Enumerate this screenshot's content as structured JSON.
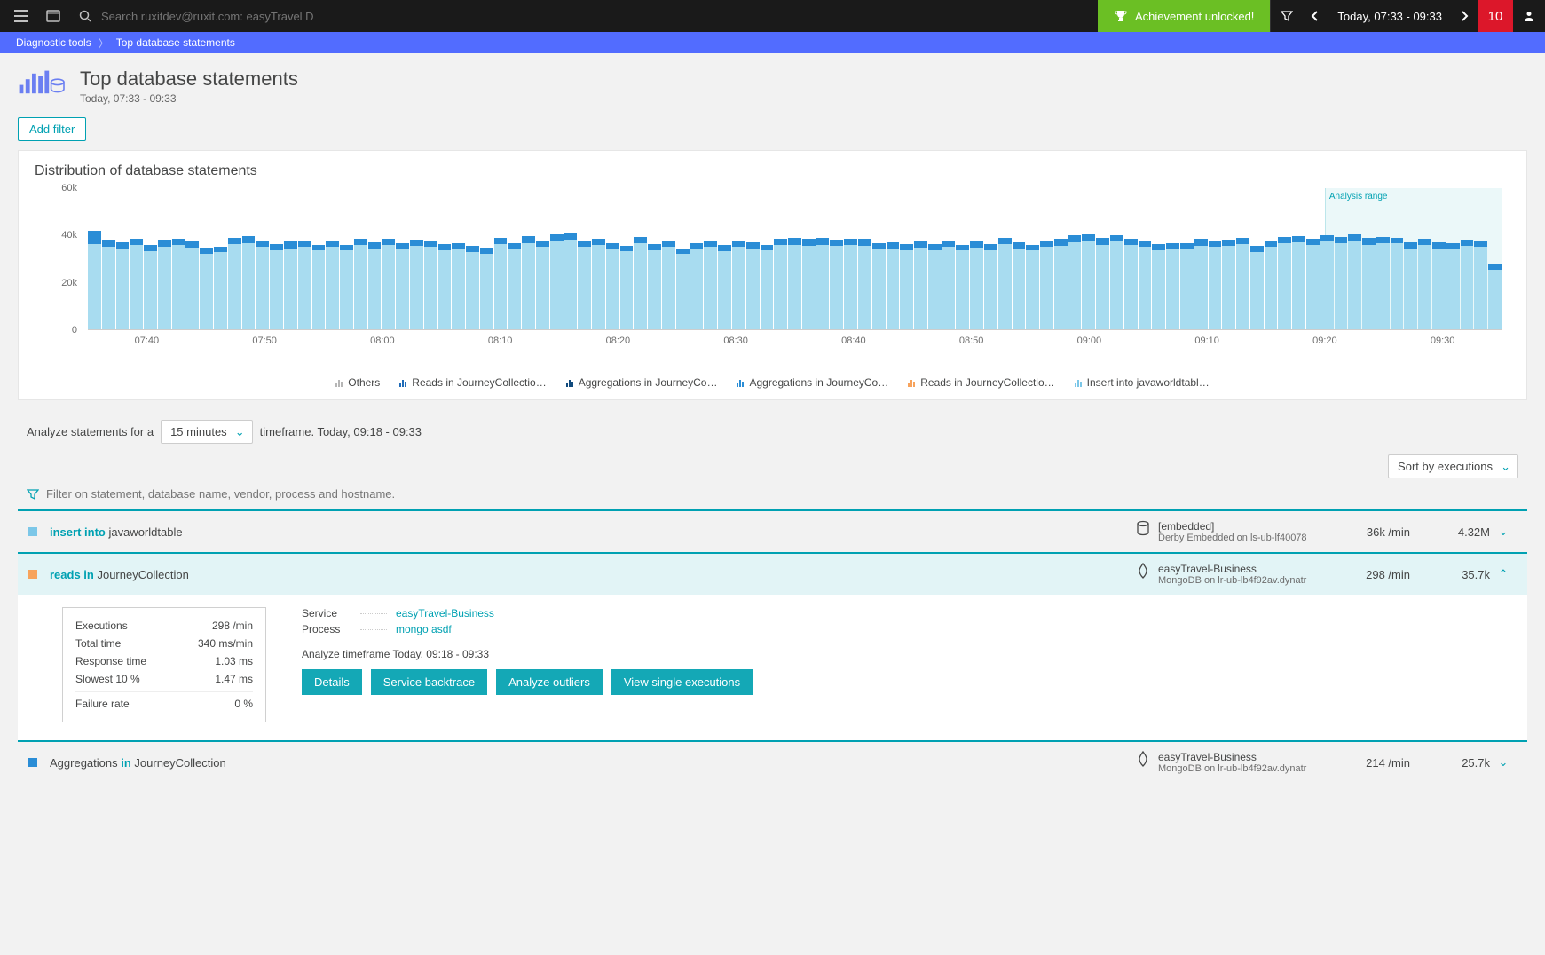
{
  "topbar": {
    "search_placeholder": "Search ruxitdev@ruxit.com: easyTravel Dev...",
    "achievement": "Achievement unlocked!",
    "time_range": "Today, 07:33 - 09:33",
    "problem_count": "10"
  },
  "breadcrumb": [
    "Diagnostic tools",
    "Top database statements"
  ],
  "page": {
    "title": "Top database statements",
    "subtitle": "Today, 07:33 - 09:33",
    "add_filter": "Add filter",
    "dist_heading": "Distribution of database statements",
    "analysis_range_label": "Analysis range",
    "analyze_prefix": "Analyze statements for a",
    "analyze_select": "15 minutes",
    "analyze_suffix": "timeframe. Today, 09:18 - 09:33",
    "sort_label": "Sort by executions",
    "filter_placeholder": "Filter on statement, database name, vendor, process and hostname."
  },
  "legend": [
    {
      "label": "Others",
      "color": "#b6b6b6"
    },
    {
      "label": "Reads in JourneyCollectio…",
      "color": "#1f6bb8"
    },
    {
      "label": "Aggregations in JourneyCo…",
      "color": "#104a7d"
    },
    {
      "label": "Aggregations in JourneyCo…",
      "color": "#2a8dd6"
    },
    {
      "label": "Reads in JourneyCollectio…",
      "color": "#f7a35c"
    },
    {
      "label": "Insert into javaworldtabl…",
      "color": "#7cc7e8"
    }
  ],
  "statements": [
    {
      "color": "#7cc7e8",
      "kw": "insert into",
      "rest": " javaworldtable",
      "db_name": "[embedded]",
      "db_sub": "Derby Embedded on ls-ub-lf40078",
      "rate": "36k /min",
      "total": "4.32M",
      "icon": "db"
    },
    {
      "color": "#f7a35c",
      "kw": "reads in",
      "rest": " JourneyCollection",
      "db_name": "easyTravel-Business",
      "db_sub": "MongoDB on lr-ub-lb4f92av.dynatr",
      "rate": "298 /min",
      "total": "35.7k",
      "icon": "mongo",
      "expanded": true
    },
    {
      "color": "#2a8dd6",
      "kw_pre": "Aggregations ",
      "kw": "in",
      "rest": " JourneyCollection",
      "db_name": "easyTravel-Business",
      "db_sub": "MongoDB on lr-ub-lb4f92av.dynatr",
      "rate": "214 /min",
      "total": "25.7k",
      "icon": "mongo"
    }
  ],
  "detail": {
    "metrics": [
      {
        "k": "Executions",
        "v": "298 /min"
      },
      {
        "k": "Total time",
        "v": "340 ms/min"
      },
      {
        "k": "Response time",
        "v": "1.03 ms"
      },
      {
        "k": "Slowest 10 %",
        "v": "1.47 ms"
      },
      {
        "k": "Failure rate",
        "v": "0 %",
        "sep": true
      }
    ],
    "service_label": "Service",
    "service_value": "easyTravel-Business",
    "process_label": "Process",
    "process_value": "mongo asdf",
    "tf": "Analyze timeframe Today, 09:18 - 09:33",
    "buttons": [
      "Details",
      "Service backtrace",
      "Analyze outliers",
      "View single executions"
    ]
  },
  "chart_data": {
    "type": "bar",
    "ylabel": "",
    "ylim": [
      0,
      60000
    ],
    "yticks": [
      "0",
      "20k",
      "40k",
      "60k"
    ],
    "xticks": [
      "07:40",
      "07:50",
      "08:00",
      "08:10",
      "08:20",
      "08:30",
      "08:40",
      "08:50",
      "09:00",
      "09:10",
      "09:20",
      "09:30"
    ],
    "analysis_start_frac": 0.875,
    "series_colors": {
      "insert": "#9fd5ea",
      "reads1": "#f7a35c",
      "agg1": "#2a8dd6",
      "agg2": "#104a7d",
      "reads2": "#1f6bb8",
      "others": "#b6b6b6"
    },
    "bars": [
      {
        "insert": 36000,
        "rest": 5500
      },
      {
        "insert": 35000,
        "rest": 3000
      },
      {
        "insert": 34000,
        "rest": 2800
      },
      {
        "insert": 35500,
        "rest": 2700
      },
      {
        "insert": 33000,
        "rest": 2500
      },
      {
        "insert": 35000,
        "rest": 2800
      },
      {
        "insert": 35800,
        "rest": 2600
      },
      {
        "insert": 34500,
        "rest": 2600
      },
      {
        "insert": 32000,
        "rest": 2500
      },
      {
        "insert": 32500,
        "rest": 2500
      },
      {
        "insert": 36000,
        "rest": 2700
      },
      {
        "insert": 36500,
        "rest": 2700
      },
      {
        "insert": 35000,
        "rest": 2600
      },
      {
        "insert": 33500,
        "rest": 2600
      },
      {
        "insert": 34000,
        "rest": 3000
      },
      {
        "insert": 35000,
        "rest": 2600
      },
      {
        "insert": 33200,
        "rest": 2600
      },
      {
        "insert": 34800,
        "rest": 2400
      },
      {
        "insert": 33200,
        "rest": 2500
      },
      {
        "insert": 35500,
        "rest": 2600
      },
      {
        "insert": 34200,
        "rest": 2600
      },
      {
        "insert": 35600,
        "rest": 2600
      },
      {
        "insert": 33800,
        "rest": 2500
      },
      {
        "insert": 35400,
        "rest": 2500
      },
      {
        "insert": 34800,
        "rest": 2700
      },
      {
        "insert": 33400,
        "rest": 2600
      },
      {
        "insert": 34000,
        "rest": 2500
      },
      {
        "insert": 32800,
        "rest": 2400
      },
      {
        "insert": 32000,
        "rest": 2500
      },
      {
        "insert": 36000,
        "rest": 2600
      },
      {
        "insert": 33800,
        "rest": 2500
      },
      {
        "insert": 36200,
        "rest": 3000
      },
      {
        "insert": 34800,
        "rest": 2700
      },
      {
        "insert": 37200,
        "rest": 2800
      },
      {
        "insert": 37800,
        "rest": 3000
      },
      {
        "insert": 34800,
        "rest": 2600
      },
      {
        "insert": 35500,
        "rest": 2600
      },
      {
        "insert": 33800,
        "rest": 2500
      },
      {
        "insert": 33000,
        "rest": 2400
      },
      {
        "insert": 36200,
        "rest": 2700
      },
      {
        "insert": 33400,
        "rest": 2600
      },
      {
        "insert": 34800,
        "rest": 2600
      },
      {
        "insert": 31800,
        "rest": 2500
      },
      {
        "insert": 33800,
        "rest": 2500
      },
      {
        "insert": 35000,
        "rest": 2600
      },
      {
        "insert": 33000,
        "rest": 2500
      },
      {
        "insert": 34800,
        "rest": 2700
      },
      {
        "insert": 34000,
        "rest": 2600
      },
      {
        "insert": 33200,
        "rest": 2500
      },
      {
        "insert": 35500,
        "rest": 2600
      },
      {
        "insert": 35800,
        "rest": 2700
      },
      {
        "insert": 35200,
        "rest": 3000
      },
      {
        "insert": 35800,
        "rest": 2700
      },
      {
        "insert": 35400,
        "rest": 2600
      },
      {
        "insert": 35800,
        "rest": 2600
      },
      {
        "insert": 35200,
        "rest": 3200
      },
      {
        "insert": 33800,
        "rest": 2600
      },
      {
        "insert": 34200,
        "rest": 2700
      },
      {
        "insert": 33400,
        "rest": 2600
      },
      {
        "insert": 34400,
        "rest": 2700
      },
      {
        "insert": 33400,
        "rest": 2700
      },
      {
        "insert": 35000,
        "rest": 2600
      },
      {
        "insert": 33200,
        "rest": 2600
      },
      {
        "insert": 34400,
        "rest": 2700
      },
      {
        "insert": 33400,
        "rest": 2600
      },
      {
        "insert": 36000,
        "rest": 2700
      },
      {
        "insert": 34200,
        "rest": 2500
      },
      {
        "insert": 33200,
        "rest": 2500
      },
      {
        "insert": 35000,
        "rest": 2600
      },
      {
        "insert": 35400,
        "rest": 2700
      },
      {
        "insert": 36800,
        "rest": 2800
      },
      {
        "insert": 37400,
        "rest": 2800
      },
      {
        "insert": 35800,
        "rest": 2700
      },
      {
        "insert": 37200,
        "rest": 2700
      },
      {
        "insert": 35600,
        "rest": 2600
      },
      {
        "insert": 34800,
        "rest": 2600
      },
      {
        "insert": 33400,
        "rest": 2500
      },
      {
        "insert": 33800,
        "rest": 2500
      },
      {
        "insert": 33800,
        "rest": 2600
      },
      {
        "insert": 35400,
        "rest": 2700
      },
      {
        "insert": 35000,
        "rest": 2600
      },
      {
        "insert": 35400,
        "rest": 2600
      },
      {
        "insert": 36000,
        "rest": 2600
      },
      {
        "insert": 32600,
        "rest": 2600
      },
      {
        "insert": 35000,
        "rest": 2600
      },
      {
        "insert": 36400,
        "rest": 2700
      },
      {
        "insert": 36800,
        "rest": 2700
      },
      {
        "insert": 35600,
        "rest": 2600
      },
      {
        "insert": 37200,
        "rest": 2700
      },
      {
        "insert": 36400,
        "rest": 2700
      },
      {
        "insert": 37400,
        "rest": 2700
      },
      {
        "insert": 35800,
        "rest": 2700
      },
      {
        "insert": 36400,
        "rest": 2700
      },
      {
        "insert": 36200,
        "rest": 2600
      },
      {
        "insert": 34200,
        "rest": 2600
      },
      {
        "insert": 35800,
        "rest": 2600
      },
      {
        "insert": 34200,
        "rest": 2600
      },
      {
        "insert": 33600,
        "rest": 2600
      },
      {
        "insert": 35200,
        "rest": 2600
      },
      {
        "insert": 34800,
        "rest": 2600
      },
      {
        "insert": 25000,
        "rest": 2400
      }
    ]
  }
}
